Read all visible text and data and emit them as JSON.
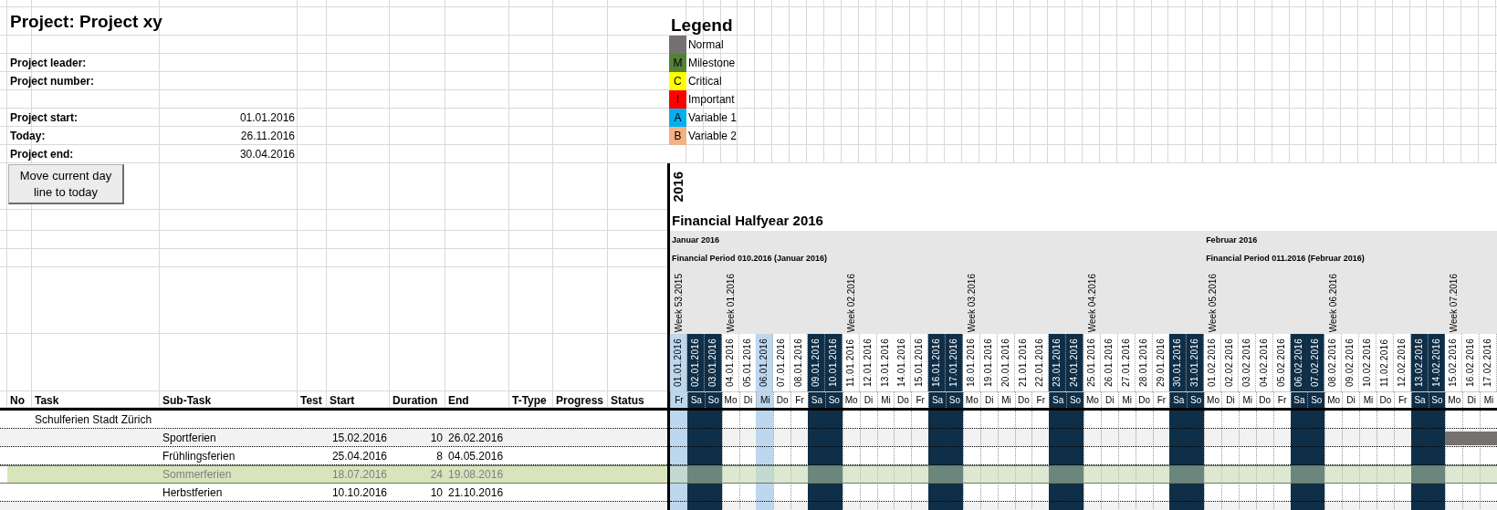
{
  "project": {
    "title": "Project: Project xy",
    "people": [
      {
        "label": "Project leader:"
      },
      {
        "label": "Project number:"
      }
    ],
    "dates": [
      {
        "label": "Project start:",
        "value": "01.01.2016"
      },
      {
        "label": "Today:",
        "value": "26.11.2016"
      },
      {
        "label": "Project end:",
        "value": "30.04.2016"
      }
    ],
    "button": "Move current day line to today"
  },
  "legend": {
    "title": "Legend",
    "items": [
      {
        "label": "Normal",
        "color": "#767171"
      },
      {
        "letter": "M",
        "label": "Milestone",
        "color": "#548235"
      },
      {
        "letter": "C",
        "label": "Critical",
        "color": "#ffff00"
      },
      {
        "letter": "I",
        "label": "Important",
        "color": "#ff0000"
      },
      {
        "letter": "A",
        "label": "Variable 1",
        "color": "#00b0f0"
      },
      {
        "letter": "B",
        "label": "Variable 2",
        "color": "#f4b183"
      }
    ]
  },
  "timeline": {
    "year": "2016",
    "title": "Financial Halfyear 2016",
    "days": [
      {
        "date": "01.01.2016",
        "day": "Fr",
        "kind": "holiday",
        "comment": true,
        "week": "Week 53.2015",
        "month": "Januar 2016",
        "period": "Financial Period 010.2016 (Januar 2016)"
      },
      {
        "date": "02.01.2016",
        "day": "Sa",
        "kind": "weekend",
        "comment": false
      },
      {
        "date": "03.01.2016",
        "day": "So",
        "kind": "weekend",
        "comment": false
      },
      {
        "date": "04.01.2016",
        "day": "Mo",
        "kind": "workday",
        "comment": false,
        "week": "Week 01.2016"
      },
      {
        "date": "05.01.2016",
        "day": "Di",
        "kind": "workday",
        "comment": false
      },
      {
        "date": "06.01.2016",
        "day": "Mi",
        "kind": "holiday",
        "comment": true
      },
      {
        "date": "07.01.2016",
        "day": "Do",
        "kind": "workday",
        "comment": false
      },
      {
        "date": "08.01.2016",
        "day": "Fr",
        "kind": "workday",
        "comment": false
      },
      {
        "date": "09.01.2016",
        "day": "Sa",
        "kind": "weekend",
        "comment": false
      },
      {
        "date": "10.01.2016",
        "day": "So",
        "kind": "weekend",
        "comment": false
      },
      {
        "date": "11.01.2016",
        "day": "Mo",
        "kind": "workday",
        "comment": false,
        "week": "Week 02.2016"
      },
      {
        "date": "12.01.2016",
        "day": "Di",
        "kind": "workday",
        "comment": false
      },
      {
        "date": "13.01.2016",
        "day": "Mi",
        "kind": "workday",
        "comment": false
      },
      {
        "date": "14.01.2016",
        "day": "Do",
        "kind": "workday",
        "comment": false
      },
      {
        "date": "15.01.2016",
        "day": "Fr",
        "kind": "workday",
        "comment": false
      },
      {
        "date": "16.01.2016",
        "day": "Sa",
        "kind": "weekend",
        "comment": false
      },
      {
        "date": "17.01.2016",
        "day": "So",
        "kind": "weekend",
        "comment": false
      },
      {
        "date": "18.01.2016",
        "day": "Mo",
        "kind": "workday",
        "comment": false,
        "week": "Week 03.2016"
      },
      {
        "date": "19.01.2016",
        "day": "Di",
        "kind": "workday",
        "comment": false
      },
      {
        "date": "20.01.2016",
        "day": "Mi",
        "kind": "workday",
        "comment": false
      },
      {
        "date": "21.01.2016",
        "day": "Do",
        "kind": "workday",
        "comment": false
      },
      {
        "date": "22.01.2016",
        "day": "Fr",
        "kind": "workday",
        "comment": false
      },
      {
        "date": "23.01.2016",
        "day": "Sa",
        "kind": "weekend",
        "comment": false
      },
      {
        "date": "24.01.2016",
        "day": "So",
        "kind": "weekend",
        "comment": false
      },
      {
        "date": "25.01.2016",
        "day": "Mo",
        "kind": "workday",
        "comment": false,
        "week": "Week 04.2016"
      },
      {
        "date": "26.01.2016",
        "day": "Di",
        "kind": "workday",
        "comment": false
      },
      {
        "date": "27.01.2016",
        "day": "Mi",
        "kind": "workday",
        "comment": false
      },
      {
        "date": "28.01.2016",
        "day": "Do",
        "kind": "workday",
        "comment": false
      },
      {
        "date": "29.01.2016",
        "day": "Fr",
        "kind": "workday",
        "comment": false
      },
      {
        "date": "30.01.2016",
        "day": "Sa",
        "kind": "weekend",
        "comment": false
      },
      {
        "date": "31.01.2016",
        "day": "So",
        "kind": "weekend",
        "comment": false
      },
      {
        "date": "01.02.2016",
        "day": "Mo",
        "kind": "workday",
        "comment": false,
        "week": "Week 05.2016",
        "month": "Februar 2016",
        "period": "Financial Period 011.2016 (Februar 2016)"
      },
      {
        "date": "02.02.2016",
        "day": "Di",
        "kind": "workday",
        "comment": false
      },
      {
        "date": "03.02.2016",
        "day": "Mi",
        "kind": "workday",
        "comment": false
      },
      {
        "date": "04.02.2016",
        "day": "Do",
        "kind": "workday",
        "comment": false
      },
      {
        "date": "05.02.2016",
        "day": "Fr",
        "kind": "workday",
        "comment": false
      },
      {
        "date": "06.02.2016",
        "day": "Sa",
        "kind": "weekend",
        "comment": false
      },
      {
        "date": "07.02.2016",
        "day": "So",
        "kind": "weekend",
        "comment": false
      },
      {
        "date": "08.02.2016",
        "day": "Mo",
        "kind": "workday",
        "comment": false,
        "week": "Week 06.2016"
      },
      {
        "date": "09.02.2016",
        "day": "Di",
        "kind": "workday",
        "comment": false
      },
      {
        "date": "10.02.2016",
        "day": "Mi",
        "kind": "workday",
        "comment": false
      },
      {
        "date": "11.02.2016",
        "day": "Do",
        "kind": "workday",
        "comment": false
      },
      {
        "date": "12.02.2016",
        "day": "Fr",
        "kind": "workday",
        "comment": false
      },
      {
        "date": "13.02.2016",
        "day": "Sa",
        "kind": "weekend",
        "comment": false
      },
      {
        "date": "14.02.2016",
        "day": "So",
        "kind": "weekend",
        "comment": false
      },
      {
        "date": "15.02.2016",
        "day": "Mo",
        "kind": "workday",
        "comment": false,
        "week": "Week 07.2016"
      },
      {
        "date": "16.02.2016",
        "day": "Di",
        "kind": "workday",
        "comment": false
      },
      {
        "date": "17.02.2016",
        "day": "Mi",
        "kind": "workday",
        "comment": false
      }
    ]
  },
  "table": {
    "columns": [
      "No",
      "Task",
      "Sub-Task",
      "Test",
      "Start",
      "Duration",
      "End",
      "T-Type",
      "Progress",
      "Status"
    ],
    "rows": [
      {
        "task": "Schulferien Stadt Zürich",
        "selected": false
      },
      {
        "sub_task": "Sportferien",
        "start": "15.02.2016",
        "duration": "10",
        "end": "26.02.2016",
        "selected": false
      },
      {
        "sub_task": "Frühlingsferien",
        "start": "25.04.2016",
        "duration": "8",
        "end": "04.05.2016",
        "selected": false
      },
      {
        "sub_task": "Sommerferien",
        "start": "18.07.2016",
        "duration": "24",
        "end": "19.08.2016",
        "selected": true
      },
      {
        "sub_task": "Herbstferien",
        "start": "10.10.2016",
        "duration": "10",
        "end": "21.10.2016",
        "selected": false
      }
    ]
  }
}
